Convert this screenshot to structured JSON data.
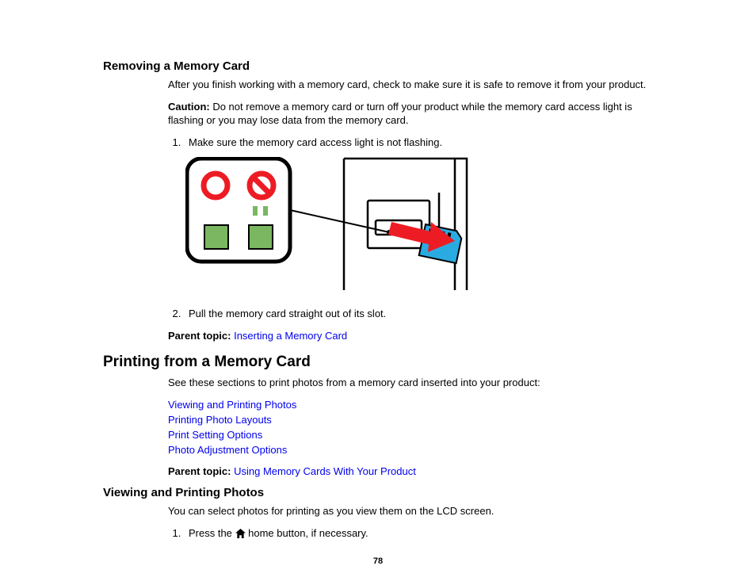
{
  "section1": {
    "heading": "Removing a Memory Card",
    "intro": "After you finish working with a memory card, check to make sure it is safe to remove it from your product.",
    "caution_label": "Caution:",
    "caution_text": " Do not remove a memory card or turn off your product while the memory card access light is flashing or you may lose data from the memory card.",
    "step1": "Make sure the memory card access light is not flashing.",
    "step2": "Pull the memory card straight out of its slot.",
    "parent_label": "Parent topic:",
    "parent_link": "Inserting a Memory Card"
  },
  "section2": {
    "heading": "Printing from a Memory Card",
    "intro": "See these sections to print photos from a memory card inserted into your product:",
    "links": {
      "0": "Viewing and Printing Photos",
      "1": "Printing Photo Layouts",
      "2": "Print Setting Options",
      "3": "Photo Adjustment Options"
    },
    "parent_label": "Parent topic:",
    "parent_link": "Using Memory Cards With Your Product"
  },
  "section3": {
    "heading": "Viewing and Printing Photos",
    "intro": "You can select photos for printing as you view them on the LCD screen.",
    "step1_a": "Press the ",
    "step1_b": " home button, if necessary."
  },
  "page_number": "78"
}
